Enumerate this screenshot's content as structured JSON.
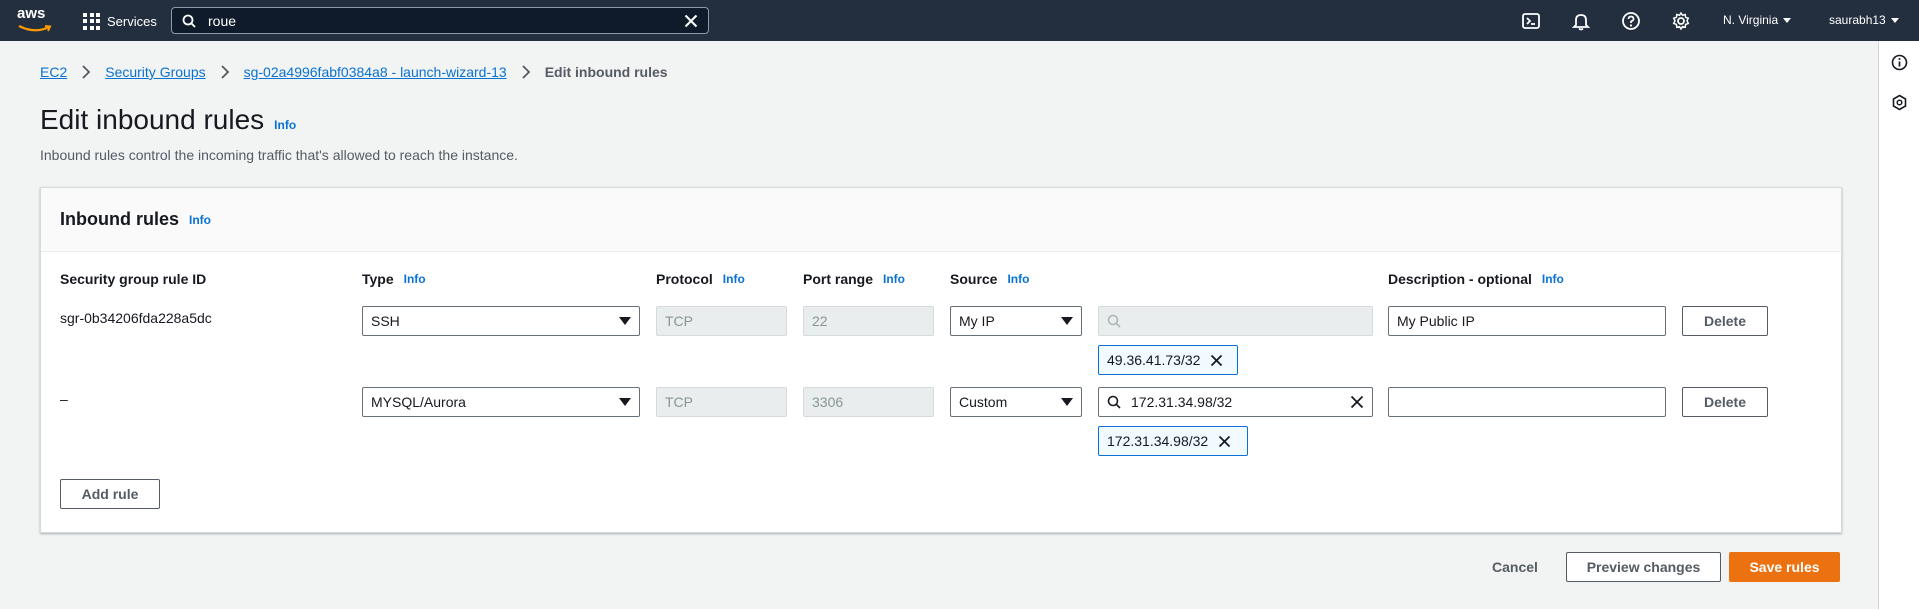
{
  "topnav": {
    "logo_text": "aws",
    "services_label": "Services",
    "search_value": "roue",
    "region_label": "N. Virginia",
    "user_label": "saurabh13",
    "icons": [
      "cloudshell-icon",
      "notifications-icon",
      "help-icon",
      "settings-icon"
    ]
  },
  "breadcrumb": {
    "items": [
      "EC2",
      "Security Groups",
      "sg-02a4996fabf0384a8 - launch-wizard-13"
    ],
    "current": "Edit inbound rules"
  },
  "page": {
    "title": "Edit inbound rules",
    "title_info": "Info",
    "subtitle": "Inbound rules control the incoming traffic that's allowed to reach the instance."
  },
  "panel": {
    "title": "Inbound rules",
    "title_info": "Info",
    "columns": {
      "rule_id": "Security group rule ID",
      "type": "Type",
      "protocol": "Protocol",
      "port_range": "Port range",
      "source": "Source",
      "description": "Description - optional",
      "info": "Info"
    },
    "rows": [
      {
        "rule_id": "sgr-0b34206fda228a5dc",
        "type": "SSH",
        "protocol": "TCP",
        "port_range": "22",
        "source": "My IP",
        "source_search": "",
        "token": "49.36.41.73/32",
        "description": "My Public IP",
        "delete_label": "Delete"
      },
      {
        "rule_id": "–",
        "type": "MYSQL/Aurora",
        "protocol": "TCP",
        "port_range": "3306",
        "source": "Custom",
        "source_search": "172.31.34.98/32",
        "token": "172.31.34.98/32",
        "description": "",
        "delete_label": "Delete"
      }
    ],
    "add_rule_label": "Add rule"
  },
  "footer": {
    "cancel_label": "Cancel",
    "preview_label": "Preview changes",
    "save_label": "Save rules"
  },
  "colors": {
    "nav_bg": "#232f3e",
    "link": "#0972d3",
    "primary": "#ec7211"
  }
}
